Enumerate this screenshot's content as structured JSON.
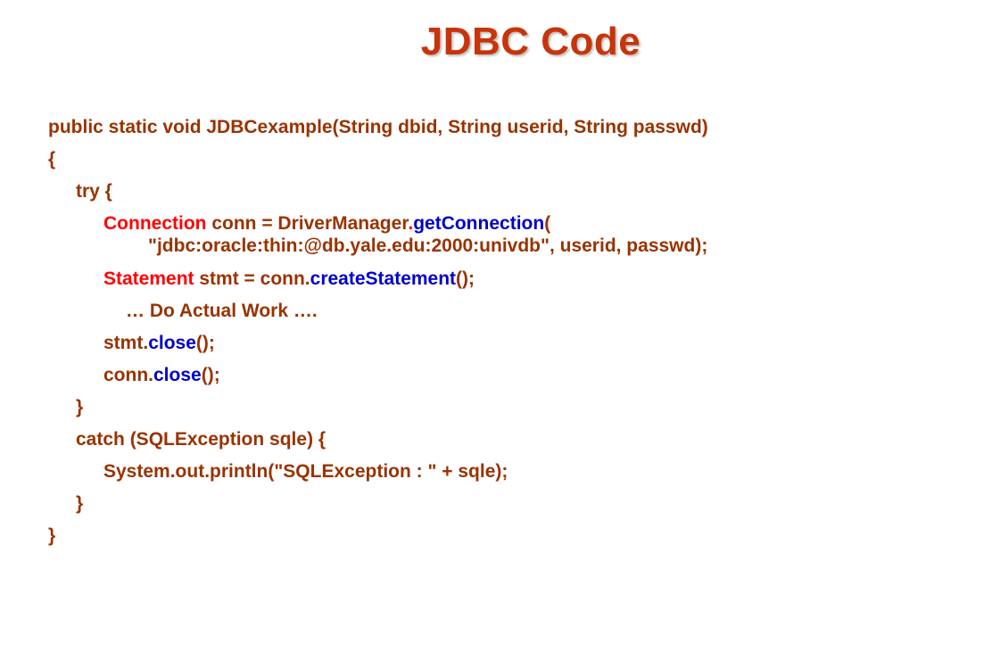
{
  "slide": {
    "title": "JDBC Code"
  },
  "code": {
    "signature": "public static void JDBCexample(String dbid, String userid, String passwd)",
    "open_brace": "{",
    "try_line": "try {",
    "conn_type": "Connection",
    "conn_mid": " conn = DriverManager",
    "conn_dot": ".",
    "conn_method": "getConnection",
    "conn_open": "(",
    "conn_args": "\"jdbc:oracle:thin:@db.yale.edu:2000:univdb\", userid, passwd);",
    "stmt_type": "Statement",
    "stmt_mid": " stmt = conn.",
    "stmt_method": "createStatement",
    "stmt_end": "();",
    "work_line": "… Do Actual Work ….",
    "stmt_close_obj": "stmt.",
    "stmt_close_method": "close",
    "stmt_close_end": "();",
    "conn_close_obj": "conn.",
    "conn_close_method": "close",
    "conn_close_end": "();",
    "try_close": "}",
    "catch_line": "catch (SQLException sqle) {",
    "println_line": "System.out.println(\"SQLException : \" + sqle);",
    "catch_close": "}",
    "close_brace": "}"
  },
  "colors": {
    "title": "#c8340a",
    "code_text": "#993300",
    "type_keyword": "#ff0000",
    "method_call": "#0000cc"
  }
}
